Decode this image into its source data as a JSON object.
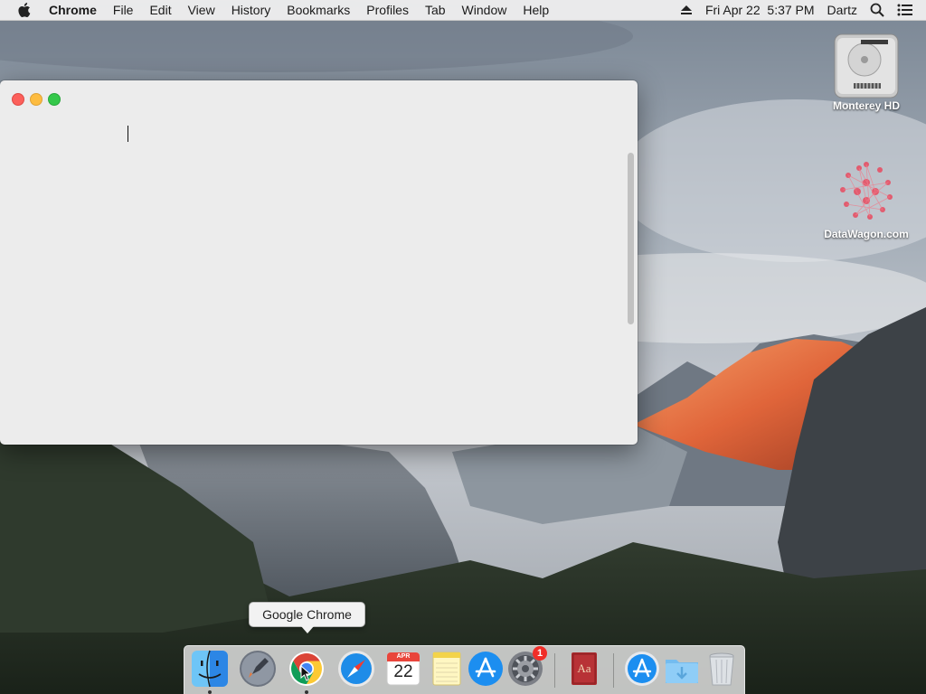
{
  "menubar": {
    "app_name": "Chrome",
    "menus": [
      "File",
      "Edit",
      "View",
      "History",
      "Bookmarks",
      "Profiles",
      "Tab",
      "Window",
      "Help"
    ],
    "datetime": "Fri Apr 22  5:37 PM",
    "user": "Dartz"
  },
  "desktop_icons": [
    {
      "label": "Monterey HD",
      "icon": "hard-drive-icon"
    },
    {
      "label": "DataWagon.com",
      "icon": "datawagon-logo-icon"
    }
  ],
  "window": {
    "title": "",
    "buttons": [
      "close",
      "minimize",
      "zoom"
    ]
  },
  "tooltip": {
    "text": "Google Chrome"
  },
  "dock": {
    "items": [
      {
        "name": "Finder",
        "icon": "finder-icon",
        "running": true
      },
      {
        "name": "Launchpad",
        "icon": "rocket-icon",
        "running": false
      },
      {
        "name": "Google Chrome",
        "icon": "chrome-icon",
        "running": true
      },
      {
        "name": "Safari",
        "icon": "safari-icon",
        "running": false
      },
      {
        "name": "Calendar",
        "icon": "calendar-icon",
        "running": false,
        "month": "APR",
        "day": "22"
      },
      {
        "name": "Notes",
        "icon": "notes-icon",
        "running": false
      },
      {
        "name": "App Store",
        "icon": "app-store-icon",
        "running": false
      },
      {
        "name": "System Preferences",
        "icon": "gear-icon",
        "running": false,
        "badge": "1"
      },
      {
        "name": "Dictionary",
        "icon": "dictionary-icon",
        "running": false,
        "label": "Aa"
      },
      {
        "name": "Applications",
        "icon": "app-store-folder-icon",
        "running": false
      },
      {
        "name": "Downloads",
        "icon": "downloads-folder-icon",
        "running": false
      },
      {
        "name": "Trash",
        "icon": "trash-icon",
        "running": false
      }
    ]
  }
}
